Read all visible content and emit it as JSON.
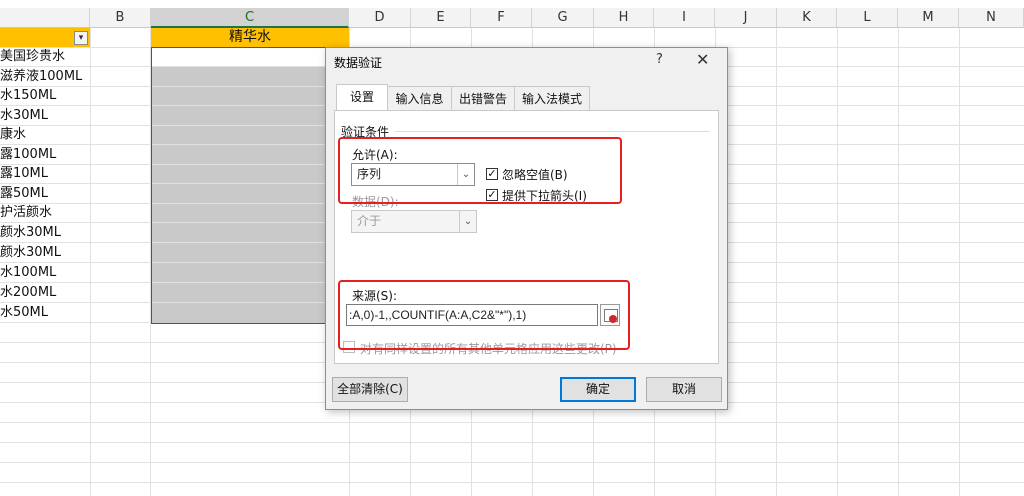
{
  "sheet": {
    "columns": [
      "B",
      "C",
      "D",
      "E",
      "F",
      "G",
      "H",
      "I",
      "J",
      "K",
      "L",
      "M",
      "N"
    ],
    "a_header_visible_text": "",
    "c_header_text": "精华水",
    "a_column_cells": [
      "美国珍贵水",
      "滋养液100ML",
      "水150ML",
      "水30ML",
      "康水",
      "露100ML",
      "露10ML",
      "露50ML",
      "护活颜水",
      "颜水30ML",
      "颜水30ML",
      "水100ML",
      "水200ML",
      "水50ML"
    ],
    "filter_glyph": "▾",
    "colors": {
      "header_fill": "#ffc000",
      "selection_border": "#217346",
      "selection_fill": "#c9c9c9"
    }
  },
  "dialog": {
    "title": "数据验证",
    "help": "?",
    "close": "✕",
    "tabs": [
      "设置",
      "输入信息",
      "出错警告",
      "输入法模式"
    ],
    "group_label": "验证条件",
    "allow_label": "允许(A):",
    "allow_value": "序列",
    "ignore_blank_label": "忽略空值(B)",
    "ignore_blank_checked": true,
    "dropdown_label": "提供下拉箭头(I)",
    "dropdown_checked": true,
    "data_label": "数据(D):",
    "data_value": "介于",
    "source_label": "来源(S):",
    "source_value": ":A,0)-1,,COUNTIF(A:A,C2&\"*\"),1)",
    "apply_all_label": "对有同样设置的所有其他单元格应用这些更改(P)",
    "apply_all_checked": false,
    "clear_all": "全部清除(C)",
    "ok": "确定",
    "cancel": "取消",
    "check_glyph": "✓",
    "arrow_glyph": "⌄",
    "highlight_color": "#e81d1d"
  }
}
